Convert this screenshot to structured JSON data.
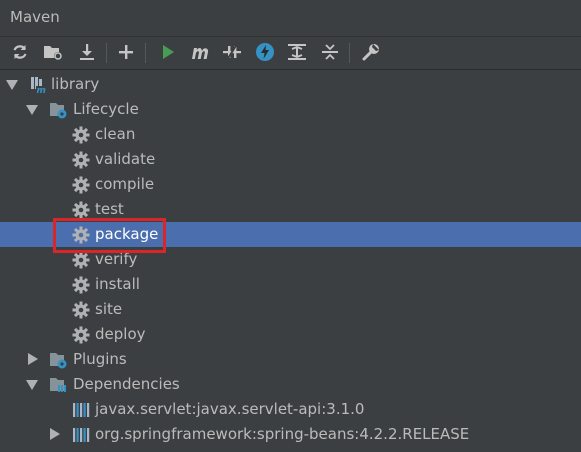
{
  "window": {
    "title": "Maven"
  },
  "toolbar": {
    "icons": [
      "reload-icon",
      "generate-sources-icon",
      "download-icon",
      "add-icon",
      "run-icon",
      "execute-goal-icon",
      "toggle-offline-icon",
      "skip-tests-icon",
      "show-dependencies-icon",
      "collapse-all-icon",
      "settings-icon"
    ]
  },
  "tree": {
    "root": {
      "label": "library"
    },
    "lifecycle": {
      "label": "Lifecycle",
      "goals": [
        "clean",
        "validate",
        "compile",
        "test",
        "package",
        "verify",
        "install",
        "site",
        "deploy"
      ],
      "selected": "package"
    },
    "plugins": {
      "label": "Plugins"
    },
    "dependencies": {
      "label": "Dependencies",
      "items": [
        "javax.servlet:javax.servlet-api:3.1.0",
        "org.springframework:spring-beans:4.2.2.RELEASE"
      ]
    }
  },
  "colors": {
    "background": "#3c3f41",
    "selection": "#4b6eaf",
    "highlight_box": "#d8262b",
    "run_green": "#499c54",
    "accent_blue": "#3592c4"
  }
}
